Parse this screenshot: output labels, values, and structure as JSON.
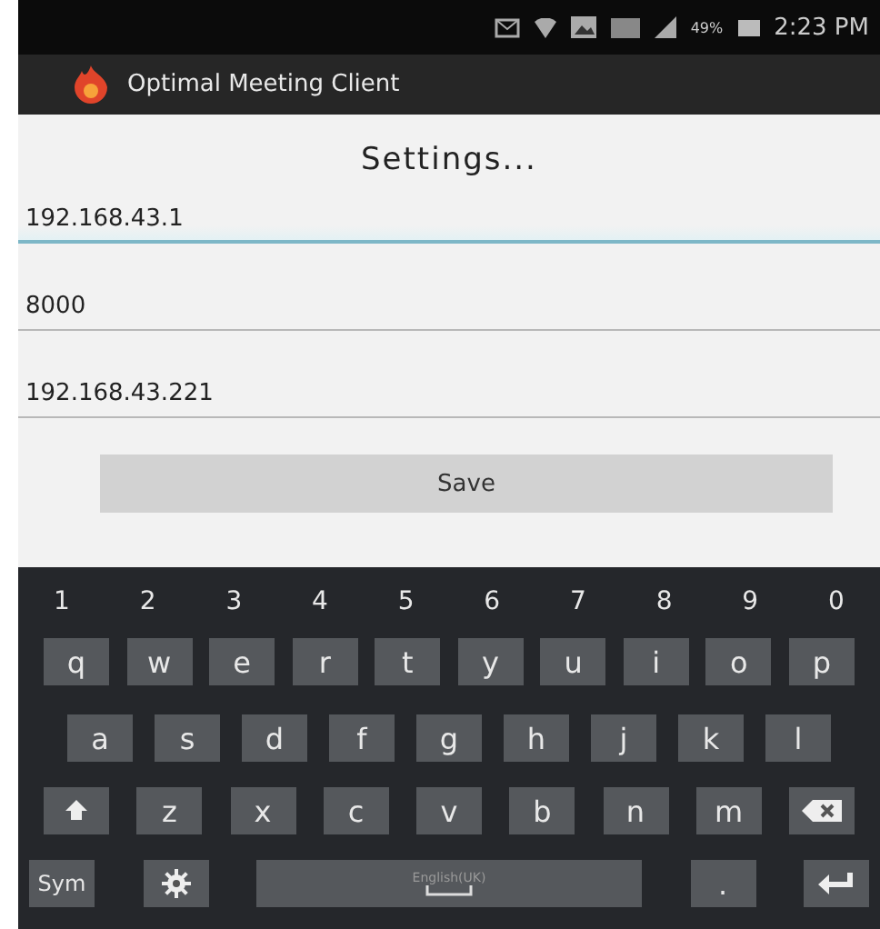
{
  "status_bar": {
    "battery_percent": "49%",
    "time": "2:23 PM"
  },
  "app_bar": {
    "title": "Optimal Meeting Client"
  },
  "heading": "Settings...",
  "fields": [
    {
      "value": "192.168.43.1",
      "focused": true
    },
    {
      "value": "8000",
      "focused": false
    },
    {
      "value": "192.168.43.221",
      "focused": false
    }
  ],
  "save_button": "Save",
  "keyboard": {
    "rows": [
      [
        {
          "kind": "number",
          "label": "1"
        },
        {
          "kind": "number",
          "label": "2"
        },
        {
          "kind": "number",
          "label": "3"
        },
        {
          "kind": "number",
          "label": "4"
        },
        {
          "kind": "number",
          "label": "5"
        },
        {
          "kind": "number",
          "label": "6"
        },
        {
          "kind": "number",
          "label": "7"
        },
        {
          "kind": "number",
          "label": "8"
        },
        {
          "kind": "number",
          "label": "9"
        },
        {
          "kind": "number",
          "label": "0"
        }
      ],
      [
        {
          "kind": "char",
          "label": "q"
        },
        {
          "kind": "char",
          "label": "w"
        },
        {
          "kind": "char",
          "label": "e"
        },
        {
          "kind": "char",
          "label": "r"
        },
        {
          "kind": "char",
          "label": "t"
        },
        {
          "kind": "char",
          "label": "y"
        },
        {
          "kind": "char",
          "label": "u"
        },
        {
          "kind": "char",
          "label": "i"
        },
        {
          "kind": "char",
          "label": "o"
        },
        {
          "kind": "char",
          "label": "p"
        }
      ],
      [
        {
          "kind": "char",
          "label": "a"
        },
        {
          "kind": "char",
          "label": "s"
        },
        {
          "kind": "char",
          "label": "d"
        },
        {
          "kind": "char",
          "label": "f"
        },
        {
          "kind": "char",
          "label": "g"
        },
        {
          "kind": "char",
          "label": "h"
        },
        {
          "kind": "char",
          "label": "j"
        },
        {
          "kind": "char",
          "label": "k"
        },
        {
          "kind": "char",
          "label": "l"
        }
      ],
      [
        {
          "kind": "shift"
        },
        {
          "kind": "char",
          "label": "z"
        },
        {
          "kind": "char",
          "label": "x"
        },
        {
          "kind": "char",
          "label": "c"
        },
        {
          "kind": "char",
          "label": "v"
        },
        {
          "kind": "char",
          "label": "b"
        },
        {
          "kind": "char",
          "label": "n"
        },
        {
          "kind": "char",
          "label": "m"
        },
        {
          "kind": "backspace"
        }
      ],
      [
        {
          "kind": "sym",
          "label": "Sym"
        },
        {
          "kind": "settings"
        },
        {
          "kind": "space",
          "label": "English(UK)"
        },
        {
          "kind": "char",
          "label": "."
        },
        {
          "kind": "enter"
        }
      ]
    ]
  }
}
